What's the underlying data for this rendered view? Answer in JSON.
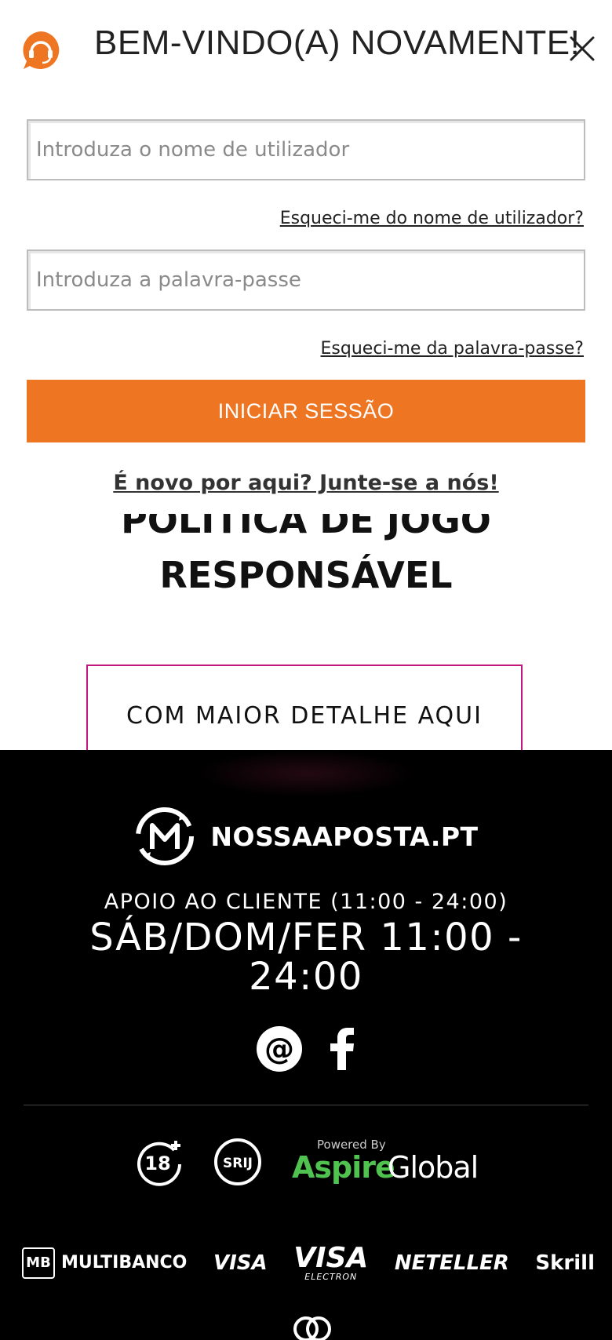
{
  "modal": {
    "title": "BEM-VINDO(A) NOVAMENTE!",
    "username_placeholder": "Introduza o nome de utilizador",
    "forgot_username": "Esqueci-me do nome de utilizador?",
    "password_placeholder": "Introduza a palavra-passe",
    "forgot_password": "Esqueci-me da palavra-passe?",
    "login_label": "INICIAR SESSÃO",
    "signup_label": "É novo por aqui? Junte-se a nós!"
  },
  "page": {
    "heading_partial": "POLÍTICA DE JOGO",
    "heading_line2": "RESPONSÁVEL",
    "detail_button": "COM MAIOR DETALHE AQUI"
  },
  "footer": {
    "brand": "NOSSAAPOSTA.PT",
    "support_label": "APOIO AO CLIENTE (11:00 - 24:00)",
    "hours": "SÁB/DOM/FER 11:00 - 24:00",
    "age_badge": "18",
    "srij_badge": "SRIJ",
    "powered_by": "Powered By",
    "aspire_a": "Aspire",
    "aspire_b": "Global",
    "payments": [
      "MULTIBANCO",
      "VISA",
      "VISA",
      "ELECTRON",
      "NETELLER",
      "Skrill"
    ],
    "mb": "MB"
  },
  "colors": {
    "accent": "#ee7623",
    "detail_border": "#c2187d",
    "aspire_green": "#4fc24f"
  }
}
